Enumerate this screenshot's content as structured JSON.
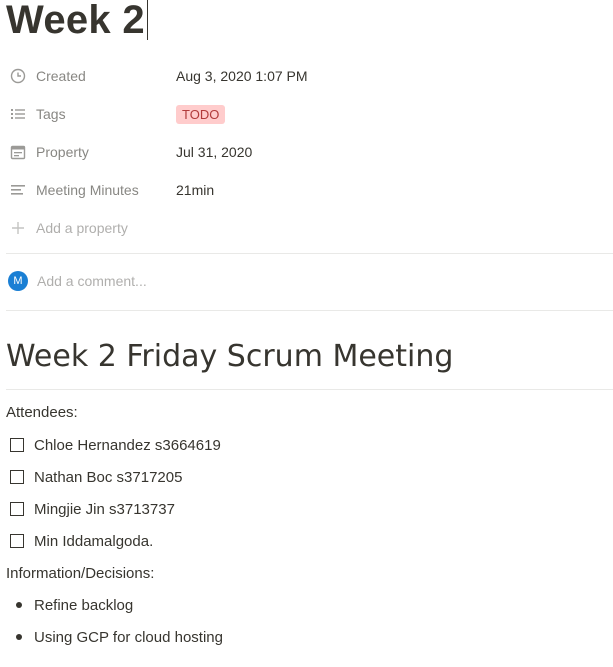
{
  "page": {
    "title": "Week 2"
  },
  "properties": [
    {
      "icon": "clock-icon",
      "label": "Created",
      "value": "Aug 3, 2020 1:07 PM"
    },
    {
      "icon": "list-icon",
      "label": "Tags",
      "value": "TODO"
    },
    {
      "icon": "calendar-icon",
      "label": "Property",
      "value": "Jul 31, 2020"
    },
    {
      "icon": "text-icon",
      "label": "Meeting Minutes",
      "value": "21min"
    }
  ],
  "add_property": {
    "icon": "plus-icon",
    "label": "Add a property"
  },
  "comment": {
    "avatar_initial": "M",
    "placeholder": "Add a comment..."
  },
  "content": {
    "heading": "Week 2 Friday Scrum Meeting",
    "attendees_label": "Attendees:",
    "attendees": [
      "Chloe Hernandez s3664619",
      "Nathan Boc s3717205",
      "Mingjie Jin s3713737",
      "Min Iddamalgoda."
    ],
    "info_label": "Information/Decisions:",
    "bullets": [
      "Refine backlog",
      "Using GCP for cloud hosting"
    ]
  },
  "colors": {
    "tag_bg": "#ffcccc",
    "avatar_bg": "#1a7fd4",
    "text": "#37352f"
  }
}
